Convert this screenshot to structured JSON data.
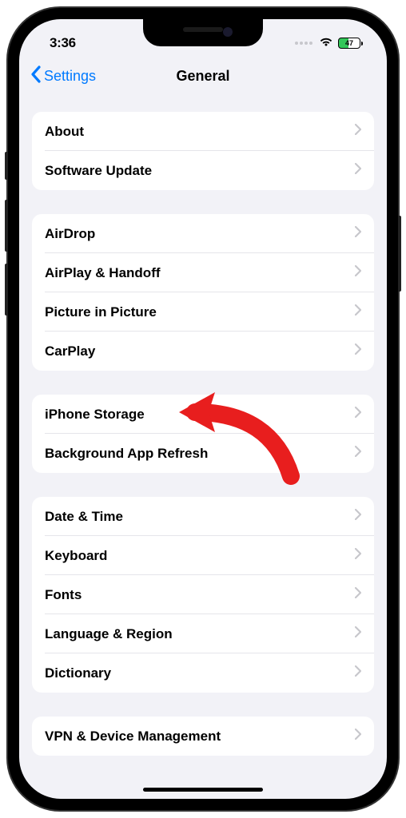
{
  "status": {
    "time": "3:36",
    "battery_text": "47"
  },
  "nav": {
    "back_label": "Settings",
    "title": "General"
  },
  "groups": [
    {
      "rows": [
        {
          "label": "About"
        },
        {
          "label": "Software Update"
        }
      ]
    },
    {
      "rows": [
        {
          "label": "AirDrop"
        },
        {
          "label": "AirPlay & Handoff"
        },
        {
          "label": "Picture in Picture"
        },
        {
          "label": "CarPlay"
        }
      ]
    },
    {
      "rows": [
        {
          "label": "iPhone Storage"
        },
        {
          "label": "Background App Refresh"
        }
      ]
    },
    {
      "rows": [
        {
          "label": "Date & Time"
        },
        {
          "label": "Keyboard"
        },
        {
          "label": "Fonts"
        },
        {
          "label": "Language & Region"
        },
        {
          "label": "Dictionary"
        }
      ]
    },
    {
      "rows": [
        {
          "label": "VPN & Device Management"
        }
      ]
    }
  ],
  "colors": {
    "accent": "#007aff",
    "background": "#f2f2f7",
    "battery_green": "#34c759",
    "annotation_red": "#e81e1e"
  }
}
